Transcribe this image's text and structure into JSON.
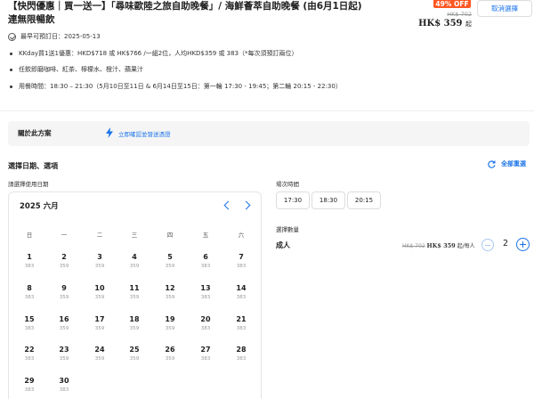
{
  "header": {
    "title": "【快閃優惠｜買一送一】「尋味歐陸之旅自助晚餐」/ 海鮮薈萃自助晚餐 (由6月1日起) 連無限暢飲",
    "discount_badge": "49% OFF",
    "original_price": "HK$ 702",
    "price": "HK$ 359",
    "price_suffix": "起",
    "cancel_button": "取消選擇"
  },
  "details": {
    "earliest_date": "最早可預訂日：2025-05-13",
    "bullets": [
      "KKday買1送1優惠：HKD$718 或 HK$766 /一組2位，人均HKD$359 或 383（*每次須預訂兩位）",
      "任飲即磨咖啡、紅茶、檸檬水、橙汁、蘋果汁",
      "用餐時間：18:30 – 21:30（5月10日至11日 & 6月14日至15日：第一輪 17:30 - 19:45；第二輪 20:15 - 22:30）"
    ]
  },
  "plan": {
    "title": "關於此方案",
    "link": "立即確認並發送憑證"
  },
  "selection": {
    "title": "選擇日期、選項",
    "reset": "全部重選",
    "date_label": "請選擇使用日期",
    "time_label": "場次時間",
    "qty_label": "選擇數量"
  },
  "calendar": {
    "month": "2025 六月",
    "weekdays": [
      "日",
      "一",
      "二",
      "三",
      "四",
      "五",
      "六"
    ],
    "days": [
      {
        "d": "1",
        "p": "383"
      },
      {
        "d": "2",
        "p": "359"
      },
      {
        "d": "3",
        "p": "359"
      },
      {
        "d": "4",
        "p": "359"
      },
      {
        "d": "5",
        "p": "359"
      },
      {
        "d": "6",
        "p": "383"
      },
      {
        "d": "7",
        "p": "383"
      },
      {
        "d": "8",
        "p": "383"
      },
      {
        "d": "9",
        "p": "359"
      },
      {
        "d": "10",
        "p": "359"
      },
      {
        "d": "11",
        "p": "359"
      },
      {
        "d": "12",
        "p": "359"
      },
      {
        "d": "13",
        "p": "383"
      },
      {
        "d": "14",
        "p": "383"
      },
      {
        "d": "15",
        "p": "383"
      },
      {
        "d": "16",
        "p": "359"
      },
      {
        "d": "17",
        "p": "359"
      },
      {
        "d": "18",
        "p": "359"
      },
      {
        "d": "19",
        "p": "359"
      },
      {
        "d": "20",
        "p": "383"
      },
      {
        "d": "21",
        "p": "383"
      },
      {
        "d": "22",
        "p": "383"
      },
      {
        "d": "23",
        "p": "359"
      },
      {
        "d": "24",
        "p": "359"
      },
      {
        "d": "25",
        "p": "359"
      },
      {
        "d": "26",
        "p": "359"
      },
      {
        "d": "27",
        "p": "383"
      },
      {
        "d": "28",
        "p": "383"
      },
      {
        "d": "29",
        "p": "383"
      },
      {
        "d": "30",
        "p": "383"
      }
    ]
  },
  "times": [
    "17:30",
    "18:30",
    "20:15"
  ],
  "quantity": {
    "label": "成人",
    "old_price": "HK$ 702",
    "price": "HK$ 359",
    "price_suffix": "起/每人",
    "value": "2"
  },
  "colors": {
    "accent": "#1a73e8",
    "discount": "#ff5722"
  }
}
